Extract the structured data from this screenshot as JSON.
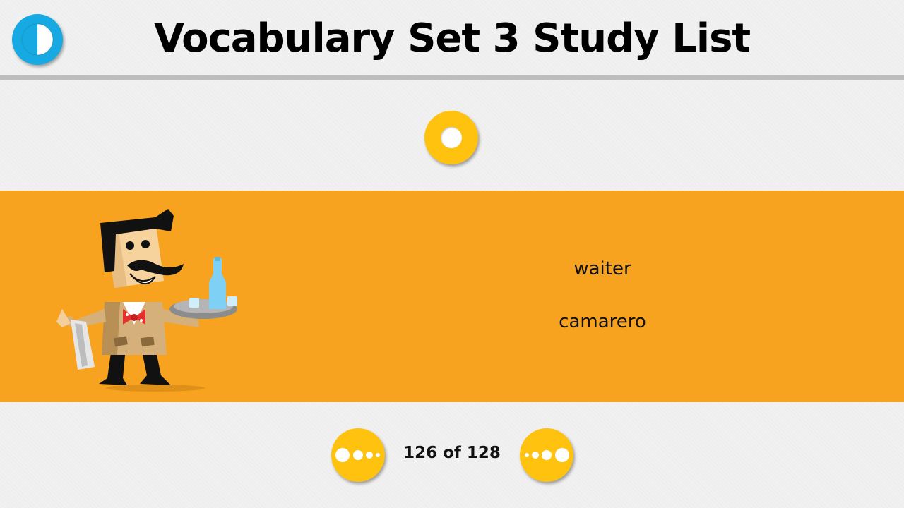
{
  "header": {
    "title": "Vocabulary Set 3 Study List",
    "back_icon": "back-circle-icon"
  },
  "audio": {
    "icon": "play-sound-icon"
  },
  "card": {
    "english": "waiter",
    "spanish": "camarero",
    "image": "waiter-illustration",
    "background_color": "#f7a320"
  },
  "pager": {
    "current": 126,
    "total": 128,
    "label": "126 of 128",
    "prev_icon": "previous-dots-icon",
    "next_icon": "next-dots-icon"
  },
  "colors": {
    "accent_yellow": "#ffc20e",
    "back_blue": "#17a9e1"
  }
}
